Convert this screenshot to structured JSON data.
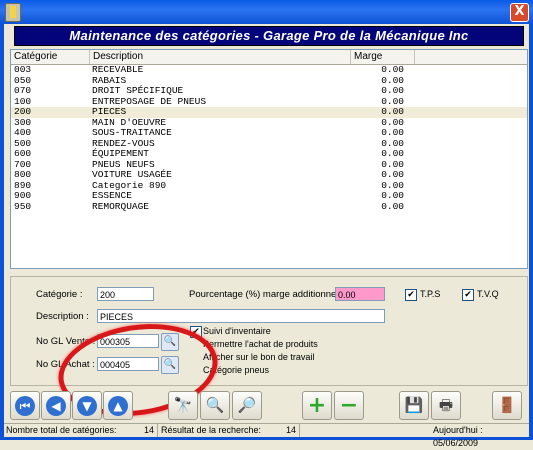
{
  "window": {
    "close_label": "X"
  },
  "banner": "Maintenance des catégories - Garage Pro de la Mécanique Inc",
  "list": {
    "headers": [
      "Catégorie",
      "Description",
      "Marge"
    ],
    "rows": [
      {
        "code": "003",
        "desc": "RECEVABLE",
        "marge": "0.00"
      },
      {
        "code": "050",
        "desc": "RABAIS",
        "marge": "0.00"
      },
      {
        "code": "070",
        "desc": "DROIT SPÉCIFIQUE",
        "marge": "0.00"
      },
      {
        "code": "100",
        "desc": "ENTREPOSAGE DE PNEUS",
        "marge": "0.00"
      },
      {
        "code": "200",
        "desc": "PIECES",
        "marge": "0.00"
      },
      {
        "code": "300",
        "desc": "MAIN D'OEUVRE",
        "marge": "0.00"
      },
      {
        "code": "400",
        "desc": "SOUS-TRAITANCE",
        "marge": "0.00"
      },
      {
        "code": "500",
        "desc": "RENDEZ-VOUS",
        "marge": "0.00"
      },
      {
        "code": "600",
        "desc": "ÉQUIPEMENT",
        "marge": "0.00"
      },
      {
        "code": "700",
        "desc": "PNEUS NEUFS",
        "marge": "0.00"
      },
      {
        "code": "800",
        "desc": "VOITURE USAGÉE",
        "marge": "0.00"
      },
      {
        "code": "890",
        "desc": "Categorie 890",
        "marge": "0.00"
      },
      {
        "code": "900",
        "desc": "ESSENCE",
        "marge": "0.00"
      },
      {
        "code": "950",
        "desc": "REMORQUAGE",
        "marge": "0.00"
      }
    ]
  },
  "detail": {
    "categorie_label": "Catégorie :",
    "categorie_value": "200",
    "pourcentage_label": "Pourcentage (%) marge additionnelle :",
    "pourcentage_value": "0.00",
    "tps_label": "T.P.S",
    "tvq_label": "T.V.Q",
    "description_label": "Description :",
    "description_value": "PIECES",
    "glv_label": "No GL Vente :",
    "glv_value": "000305",
    "gla_label": "No GL Achat :",
    "gla_value": "000405",
    "suivi_label": "Suivi d'inventaire",
    "permettre_label": "Permettre l'achat de produits",
    "afficher_label": "Afficher sur le bon de travail",
    "pneus_label": "Catégorie pneus"
  },
  "status": {
    "total_label": "Nombre total de catégories:",
    "total_value": "14",
    "result_label": "Résultat de la recherche:",
    "result_value": "14",
    "date_label": "Aujourd'hui : 05/06/2009"
  },
  "colors": {
    "banner_bg": "#04047a",
    "title_bar": "#0d52d6",
    "marge_field": "#ff99cc",
    "annotation": "#d81818"
  }
}
